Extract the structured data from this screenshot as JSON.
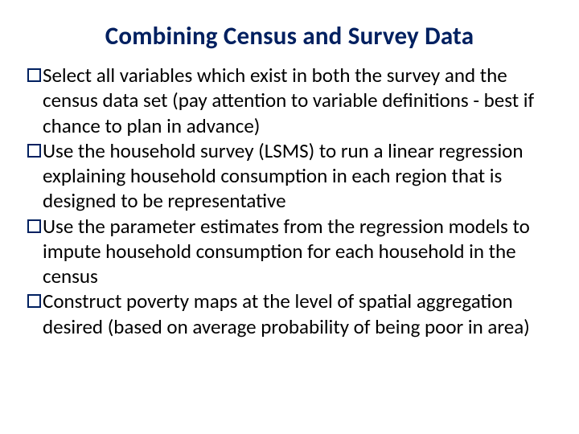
{
  "title": "Combining Census and Survey Data",
  "bullets": [
    {
      "text": "Select all variables which exist in both the survey and the census data set (pay attention to variable definitions - best if chance to plan in advance)"
    },
    {
      "text": "Use the household survey (LSMS) to run a linear regression explaining household consumption in each region that is designed to be representative"
    },
    {
      "text": "Use the parameter estimates from the regression models to impute household consumption for each household in the census"
    },
    {
      "text": "Construct poverty maps at the level of spatial aggregation desired (based on average probability of being poor in area)"
    }
  ]
}
